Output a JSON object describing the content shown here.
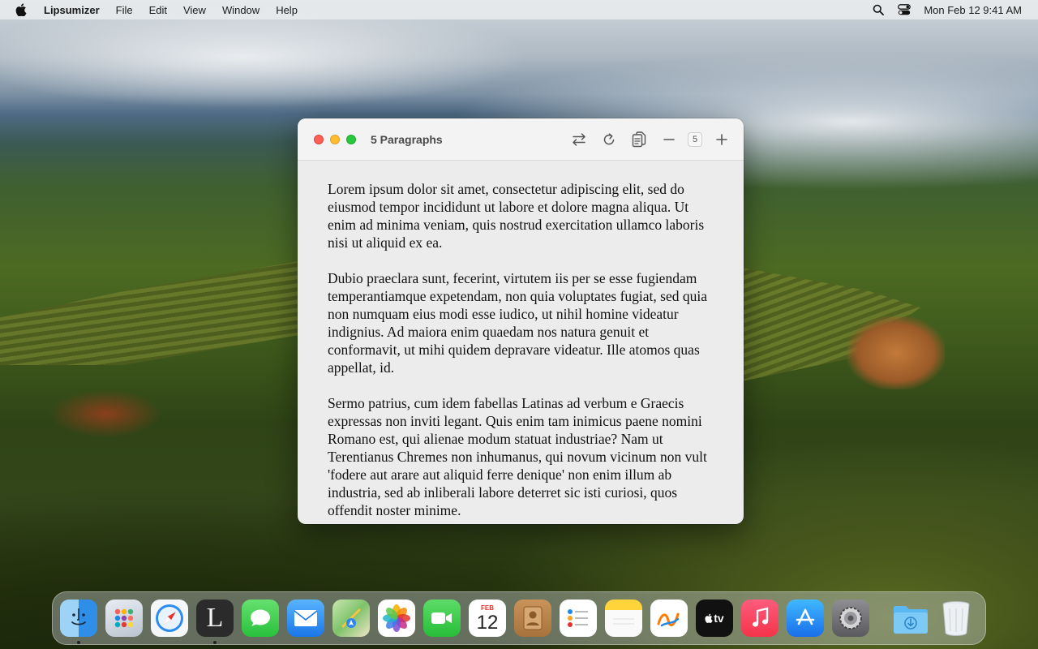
{
  "menubar": {
    "app_name": "Lipsumizer",
    "items": [
      "File",
      "Edit",
      "View",
      "Window",
      "Help"
    ],
    "clock": "Mon Feb 12  9:41 AM"
  },
  "window": {
    "title": "5 Paragraphs",
    "paragraph_count": "5",
    "paragraphs": [
      "Lorem ipsum dolor sit amet, consectetur adipiscing elit, sed do eiusmod tempor incididunt ut labore et dolore magna aliqua. Ut enim ad minima veniam, quis nostrud exercitation ullamco laboris nisi ut aliquid ex ea.",
      "Dubio praeclara sunt, fecerint, virtutem iis per se esse fugiendam temperantiamque expetendam, non quia voluptates fugiat, sed quia non numquam eius modi esse iudico, ut nihil homine videatur indignius. Ad maiora enim quaedam nos natura genuit et conformavit, ut mihi quidem depravare videatur. Ille atomos quas appellat, id.",
      "Sermo patrius, cum idem fabellas Latinas ad verbum e Graecis expressas non inviti legant. Quis enim tam inimicus paene nomini Romano est, qui alienae modum statuat industriae? Nam ut Terentianus Chremes non inhumanus, qui novum vicinum non vult 'fodere aut arare aut aliquid ferre denique' non enim illum ab industria, sed ab inliberali labore deterret sic isti curiosi, quos offendit noster minime."
    ]
  },
  "dock": {
    "calendar_month": "FEB",
    "calendar_day": "12",
    "lipsumizer_letter": "L",
    "tv_label": "tv"
  },
  "colors": {
    "close": "#ff5f57",
    "minimize": "#febc2e",
    "maximize": "#28c840"
  }
}
